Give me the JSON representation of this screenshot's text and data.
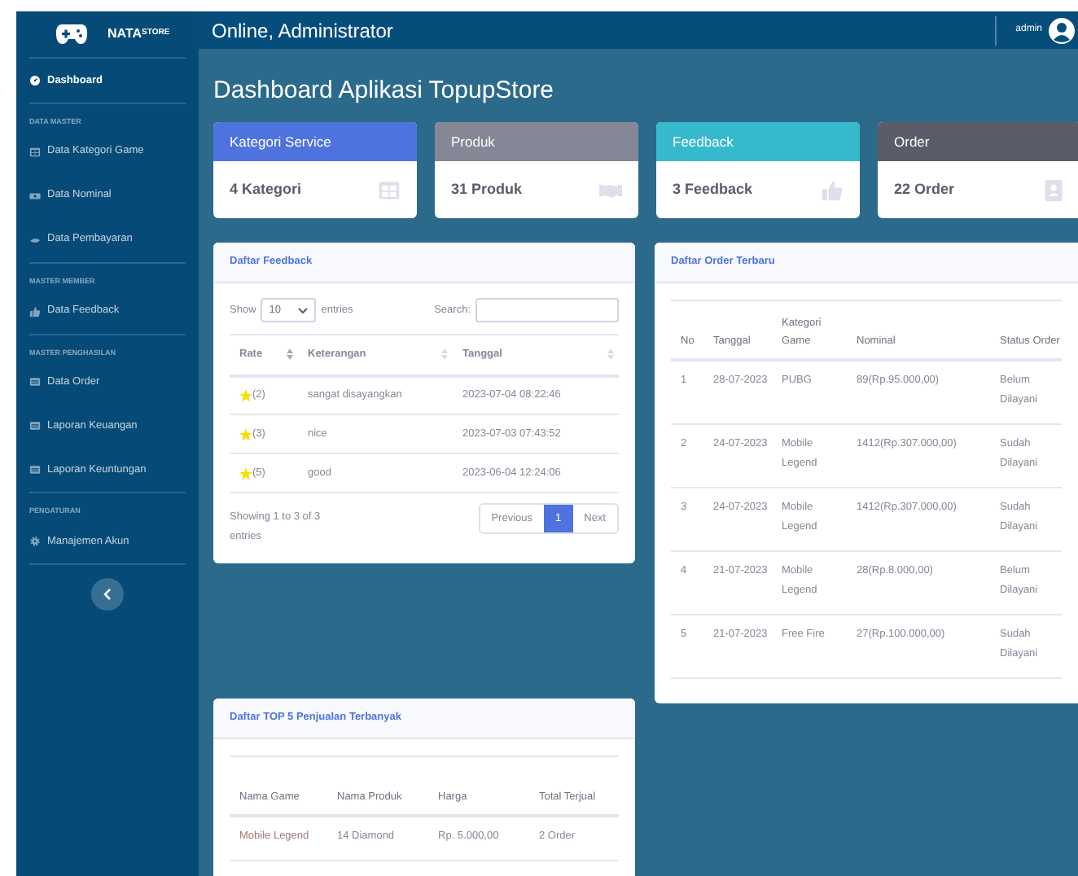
{
  "brand": {
    "name": "NATA",
    "sup": "STORE"
  },
  "topbar": {
    "title": "Online, Administrator",
    "user": "admin"
  },
  "sidebar": {
    "items": [
      {
        "kind": "item",
        "label": "Dashboard",
        "selected": true
      },
      {
        "kind": "heading",
        "label": "DATA MASTER"
      },
      {
        "kind": "item",
        "label": "Data Kategori Game",
        "selected": false
      },
      {
        "kind": "item",
        "label": "Data Nominal",
        "selected": false
      },
      {
        "kind": "item",
        "label": "Data Pembayaran",
        "selected": false
      },
      {
        "kind": "heading",
        "label": "MASTER MEMBER"
      },
      {
        "kind": "item",
        "label": "Data Feedback",
        "selected": false
      },
      {
        "kind": "heading",
        "label": "MASTER PENGHASILAN"
      },
      {
        "kind": "item",
        "label": "Data Order",
        "selected": false
      },
      {
        "kind": "item",
        "label": "Laporan Keuangan",
        "selected": false
      },
      {
        "kind": "item",
        "label": "Laporan Keuntungan",
        "selected": false
      },
      {
        "kind": "heading",
        "label": "PENGATURAN"
      },
      {
        "kind": "item",
        "label": "Manajemen Akun",
        "selected": false
      }
    ]
  },
  "page_title": "Dashboard Aplikasi TopupStore",
  "stat_cards": [
    {
      "title": "Kategori Service",
      "value": "4 Kategori",
      "color": "#4e73df"
    },
    {
      "title": "Produk",
      "value": "31 Produk",
      "color": "#858796"
    },
    {
      "title": "Feedback",
      "value": "3 Feedback",
      "color": "#36b9cc"
    },
    {
      "title": "Order",
      "value": "22 Order",
      "color": "#5a5c69"
    }
  ],
  "feedback_panel": {
    "title": "Daftar Feedback",
    "show_label": "Show",
    "page_size": "10",
    "entries_label": "entries",
    "search_label": "Search:",
    "columns": [
      "Rate",
      "Keterangan",
      "Tanggal"
    ],
    "rows": [
      [
        "(2)",
        "sangat disayangkan",
        "2023-07-04 08:22:46"
      ],
      [
        "(3)",
        "nice",
        "2023-07-03 07:43:52"
      ],
      [
        "(5)",
        "good",
        "2023-06-04 12:24:06"
      ]
    ],
    "info": "Showing 1 to 3 of 3 entries",
    "pagination": [
      {
        "label": "Previous",
        "selected": false
      },
      {
        "label": "1",
        "selected": true
      },
      {
        "label": "Next",
        "selected": false
      }
    ]
  },
  "order_panel": {
    "title": "Daftar Order Terbaru",
    "columns": [
      "No",
      "Tanggal",
      "Kategori Game",
      "Nominal",
      "Status Order"
    ],
    "rows": [
      [
        "1",
        "28-07-2023",
        "PUBG",
        "89(Rp.95.000,00)",
        "Belum Dilayani"
      ],
      [
        "2",
        "24-07-2023",
        "Mobile Legend",
        "1412(Rp.307.000,00)",
        "Sudah Dilayani"
      ],
      [
        "3",
        "24-07-2023",
        "Mobile Legend",
        "1412(Rp.307.000,00)",
        "Sudah Dilayani"
      ],
      [
        "4",
        "21-07-2023",
        "Mobile Legend",
        "28(Rp.8.000,00)",
        "Belum Dilayani"
      ],
      [
        "5",
        "21-07-2023",
        "Free Fire",
        "27(Rp.100.000,00)",
        "Sudah Dilayani"
      ]
    ]
  },
  "top_panel": {
    "title": "Daftar TOP 5 Penjualan Terbanyak",
    "columns": [
      "Nama Game",
      "Nama Produk",
      "Harga",
      "Total Terjual"
    ],
    "rows": [
      [
        "Mobile Legend",
        "14 Diamond",
        "Rp. 5.000,00",
        "2 Order"
      ]
    ]
  }
}
